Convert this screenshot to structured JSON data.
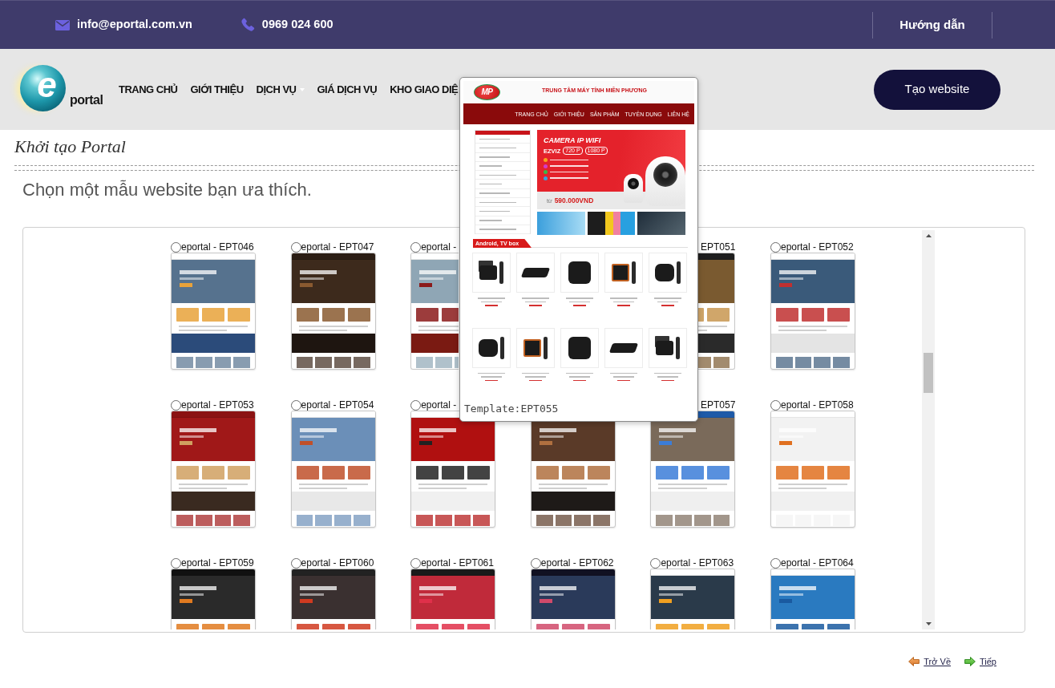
{
  "top_bar": {
    "email": "info@eportal.com.vn",
    "phone": "0969 024 600",
    "help_link": "Hướng dẫn"
  },
  "header": {
    "logo": {
      "letter": "e",
      "wordmark": "portal"
    },
    "menu": [
      {
        "label": "TRANG CHỦ",
        "dropdown": false
      },
      {
        "label": "GIỚI THIỆU",
        "dropdown": false
      },
      {
        "label": "DỊCH VỤ",
        "dropdown": true
      },
      {
        "label": "GIÁ DỊCH VỤ",
        "dropdown": false
      },
      {
        "label": "KHO GIAO DIỆ",
        "dropdown": false
      }
    ],
    "cta_button": "Tạo website"
  },
  "page_title": "Khởi tạo Portal",
  "instruction": "Chọn một mẫu website bạn ưa thích.",
  "template_grid": {
    "rows": [
      [
        {
          "kind": "option",
          "label": "eportal - EPT046",
          "selected": false
        },
        {
          "kind": "option",
          "label": "eportal - EPT047",
          "selected": false
        },
        {
          "kind": "left_part",
          "label": "eportal -",
          "selected": false
        },
        {
          "kind": "covered"
        },
        {
          "kind": "right_part",
          "label": "EPT051"
        },
        {
          "kind": "option",
          "label": "eportal - EPT052",
          "selected": false
        }
      ],
      [
        {
          "kind": "option",
          "label": "eportal - EPT053",
          "selected": false
        },
        {
          "kind": "option",
          "label": "eportal - EPT054",
          "selected": false
        },
        {
          "kind": "option",
          "label": "eportal -",
          "selected": false
        },
        {
          "kind": "picture"
        },
        {
          "kind": "tail",
          "label": "EPT057"
        },
        {
          "kind": "option",
          "label": "eportal - EPT058",
          "selected": false
        }
      ],
      [
        {
          "kind": "option",
          "label": "eportal - EPT059",
          "selected": false
        },
        {
          "kind": "option",
          "label": "eportal - EPT060",
          "selected": false
        },
        {
          "kind": "option",
          "label": "eportal - EPT061",
          "selected": false
        },
        {
          "kind": "option",
          "label": "eportal - EPT062",
          "selected": false
        },
        {
          "kind": "option",
          "label": "eportal - EPT063",
          "selected": false
        },
        {
          "kind": "option",
          "label": "eportal - EPT064",
          "selected": false
        }
      ]
    ]
  },
  "preview_popup": {
    "screenshot": {
      "logo": "MP",
      "site_title": "TRUNG TÂM MÁY TÍNH MIỀN PHƯƠNG",
      "menu": [
        "TRANG CHỦ",
        "GIỚI THIỆU",
        "SẢN PHẨM",
        "TUYỂN DỤNG",
        "LIÊN HỆ"
      ],
      "banner": {
        "title": "CAMERA IP WIFI",
        "brand": "EZVIZ",
        "badges": [
          "720 P",
          "1080 P"
        ],
        "price_prefix": "từ",
        "price": "590.000VND"
      },
      "section_title": "Android, TV box"
    },
    "caption": "Template:EPT055"
  },
  "page_links": {
    "back": "Trở Về",
    "next": "Tiếp"
  }
}
